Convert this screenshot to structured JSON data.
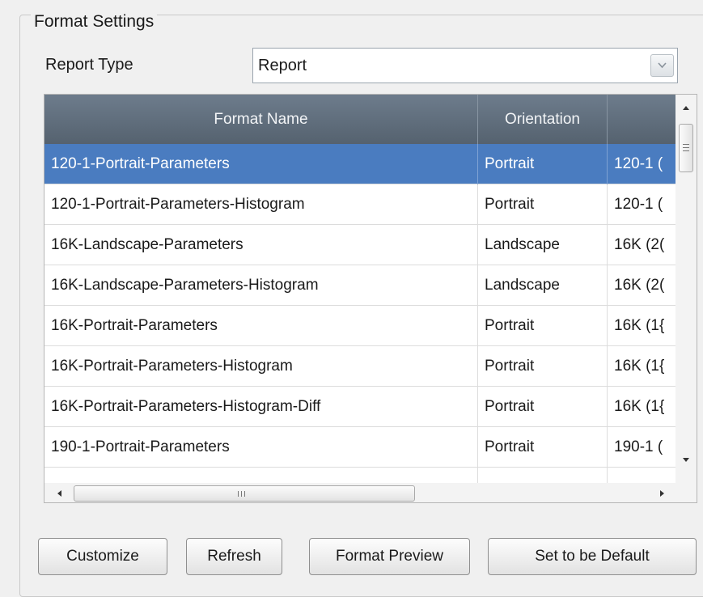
{
  "group": {
    "title": "Format Settings"
  },
  "report_type": {
    "label": "Report Type",
    "value": "Report"
  },
  "table": {
    "headers": [
      "Format Name",
      "Orientation",
      ""
    ],
    "rows": [
      {
        "name": "120-1-Portrait-Parameters",
        "orientation": "Portrait",
        "size": "120-1 (",
        "selected": true
      },
      {
        "name": "120-1-Portrait-Parameters-Histogram",
        "orientation": "Portrait",
        "size": "120-1 ("
      },
      {
        "name": "16K-Landscape-Parameters",
        "orientation": "Landscape",
        "size": "16K (2("
      },
      {
        "name": "16K-Landscape-Parameters-Histogram",
        "orientation": "Landscape",
        "size": "16K (2("
      },
      {
        "name": "16K-Portrait-Parameters",
        "orientation": "Portrait",
        "size": "16K (1{"
      },
      {
        "name": "16K-Portrait-Parameters-Histogram",
        "orientation": "Portrait",
        "size": "16K (1{"
      },
      {
        "name": "16K-Portrait-Parameters-Histogram-Diff",
        "orientation": "Portrait",
        "size": "16K (1{"
      },
      {
        "name": "190-1-Portrait-Parameters",
        "orientation": "Portrait",
        "size": "190-1 ("
      }
    ]
  },
  "buttons": {
    "customize": "Customize",
    "refresh": "Refresh",
    "format_preview": "Format Preview",
    "set_default": "Set to be Default"
  },
  "colors": {
    "selection": "#4a7cc0",
    "header": "#5f6d7b"
  }
}
